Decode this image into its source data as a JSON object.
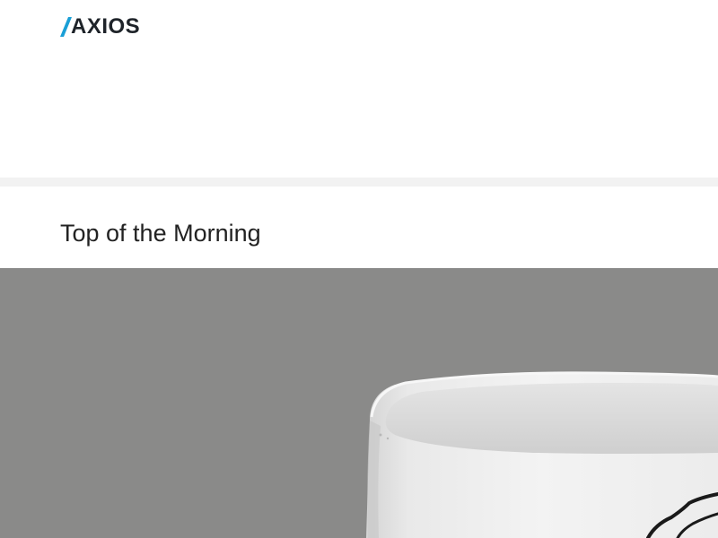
{
  "brand": {
    "name": "AXIOS",
    "accent_color": "#1a9fd6",
    "text_color": "#1e2329"
  },
  "section": {
    "title": "Top of the Morning"
  },
  "hero": {
    "background_color": "#8a8a89",
    "image_subject": "white-coffee-mug"
  }
}
